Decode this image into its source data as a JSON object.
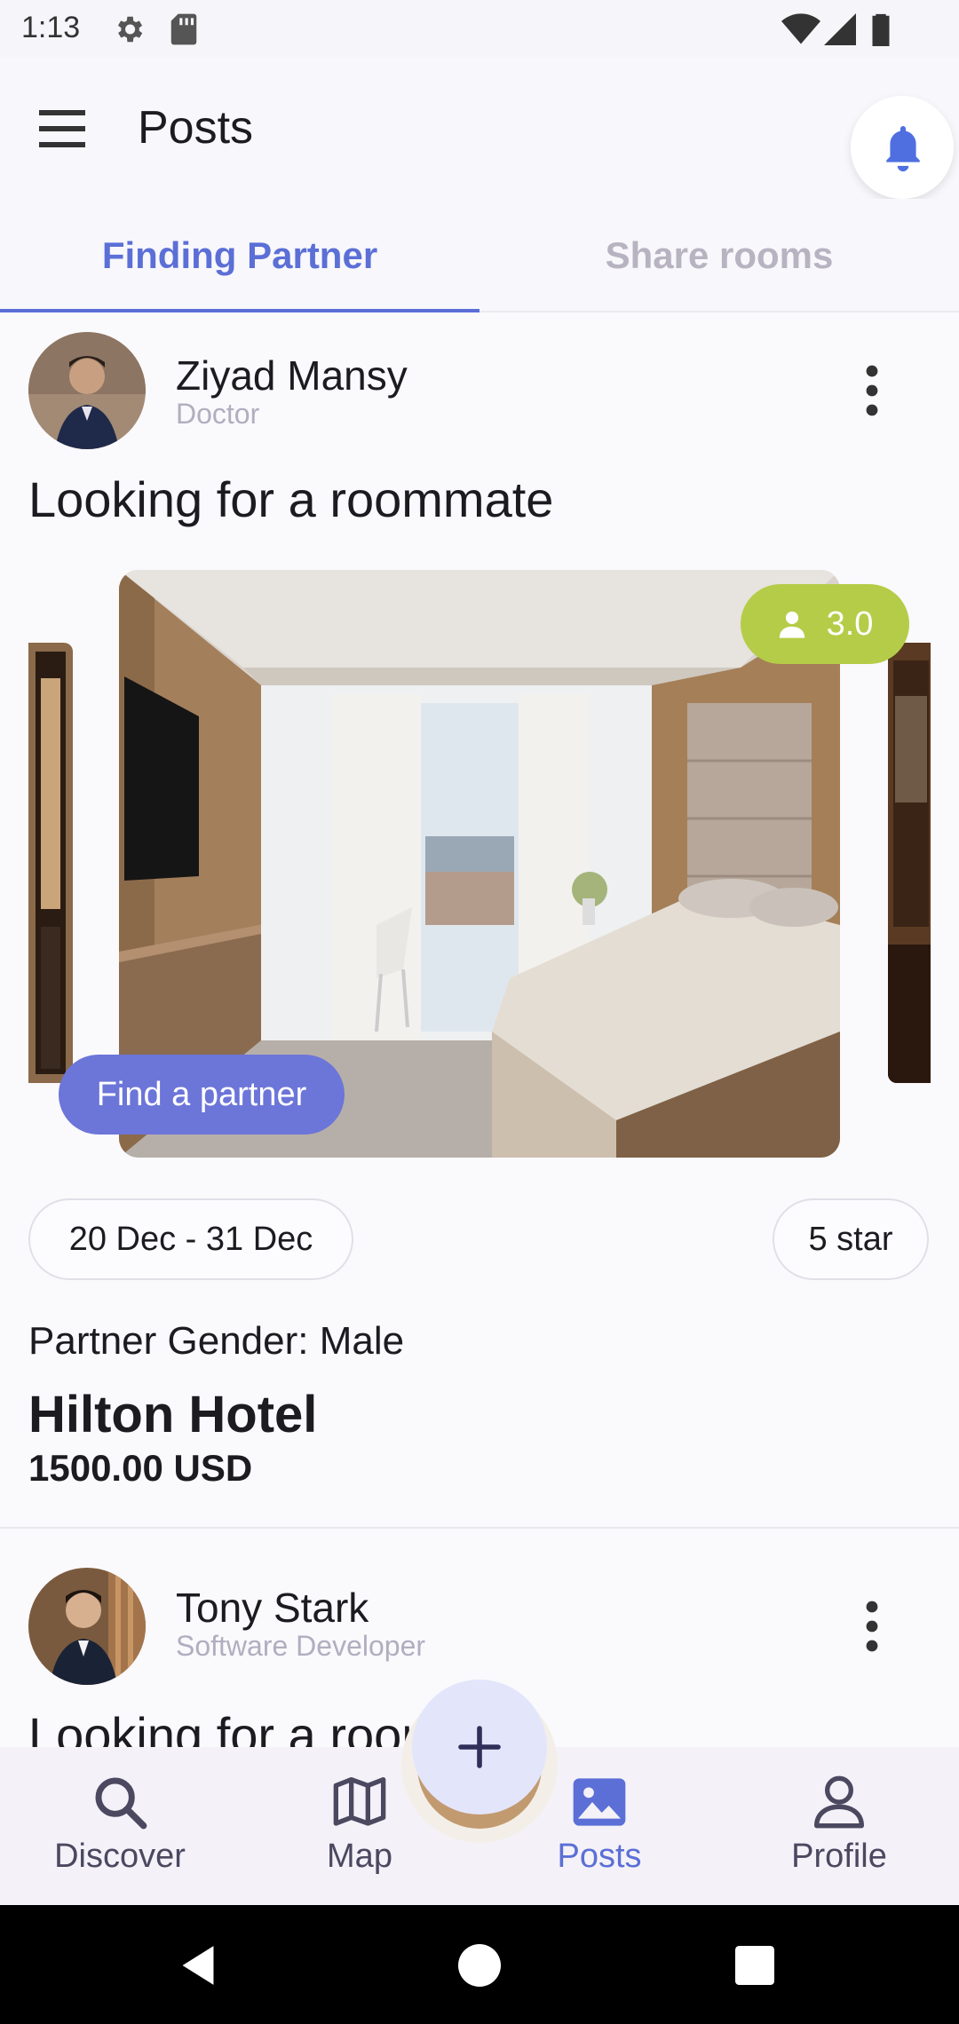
{
  "status_bar": {
    "time": "1:13"
  },
  "header": {
    "title": "Posts"
  },
  "tabs": [
    {
      "label": "Finding Partner",
      "active": true
    },
    {
      "label": "Share rooms",
      "active": false
    }
  ],
  "posts": [
    {
      "author": "Ziyad Mansy",
      "role": "Doctor",
      "title": "Looking for a roommate",
      "rating": "3.0",
      "cta": "Find a partner",
      "date_range": "20 Dec - 31 Dec",
      "stars": "5 star",
      "gender": "Partner Gender: Male",
      "hotel": "Hilton Hotel",
      "price": "1500.00 USD"
    },
    {
      "author": "Tony Stark",
      "role": "Software Developer",
      "title": "Looking for a roommate"
    }
  ],
  "fab": {
    "label": "+"
  },
  "bottom_nav": [
    {
      "label": "Discover",
      "icon": "search-icon",
      "active": false
    },
    {
      "label": "Map",
      "icon": "map-icon",
      "active": false
    },
    {
      "label": "Posts",
      "icon": "image-icon",
      "active": true
    },
    {
      "label": "Profile",
      "icon": "person-icon",
      "active": false
    }
  ],
  "colors": {
    "accent": "#5b6fd6",
    "rating_chip": "#b5cc48",
    "partner_button": "#6c75d8",
    "fab": "#e3e5fb"
  }
}
